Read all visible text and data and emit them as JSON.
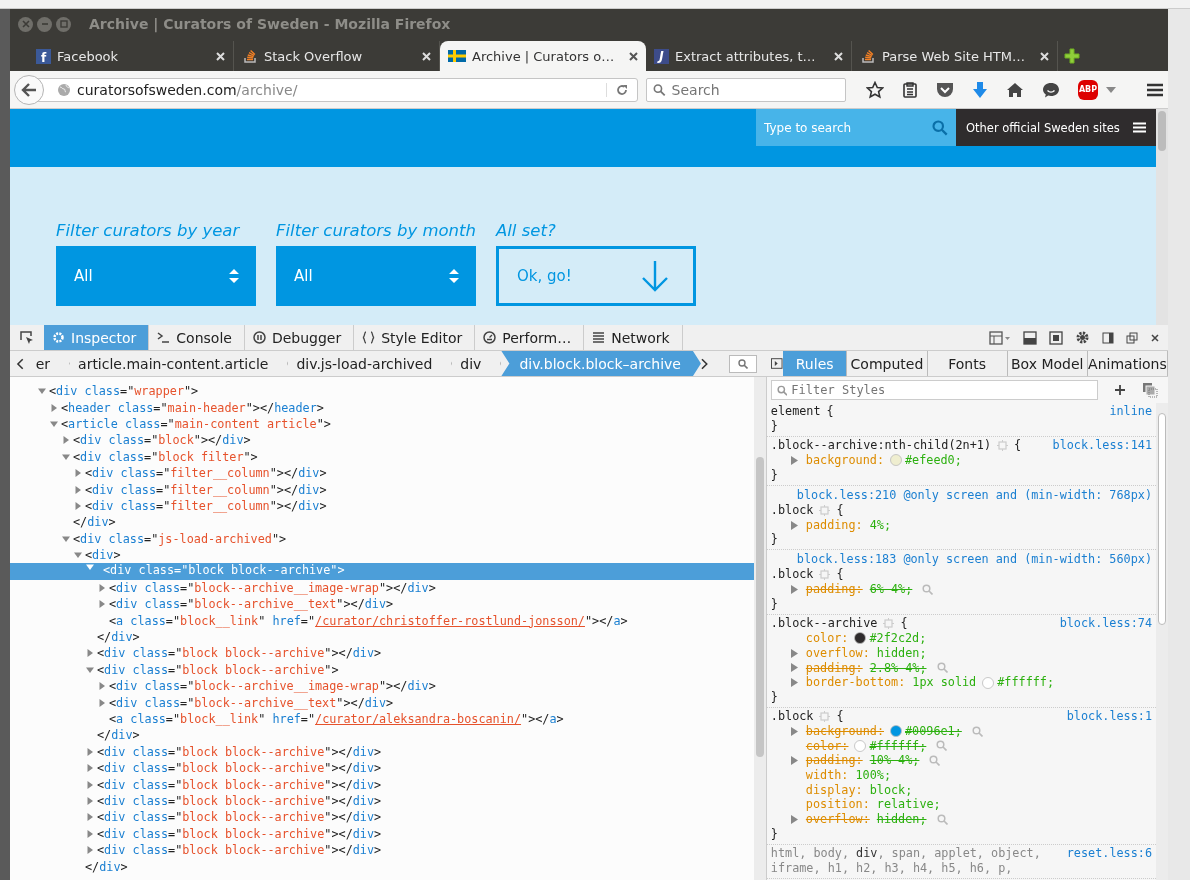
{
  "window": {
    "title": "Archive | Curators of Sweden - Mozilla Firefox"
  },
  "tabs": [
    {
      "label": "Facebook",
      "selected": false,
      "kind": "letter",
      "icon_text": "f"
    },
    {
      "label": "Stack Overflow",
      "selected": false,
      "kind": "stack"
    },
    {
      "label": "Archive | Curators o…",
      "selected": true,
      "kind": "flag"
    },
    {
      "label": "Extract attributes, t…",
      "selected": false,
      "kind": "letter",
      "icon_text": "J"
    },
    {
      "label": "Parse Web Site HTM…",
      "selected": false,
      "kind": "stack"
    }
  ],
  "navbar": {
    "url_host": "curatorsofsweden.com",
    "url_path": "/archive/",
    "search_placeholder": "Search",
    "adblock_text": "ABP"
  },
  "page": {
    "search_placeholder": "Type to search",
    "sites_link": "Other official Sweden sites",
    "filters": [
      {
        "label": "Filter curators by year",
        "value": "All"
      },
      {
        "label": "Filter curators by month",
        "value": "All"
      }
    ],
    "submit": {
      "label": "All set?",
      "button": "Ok, go!"
    }
  },
  "devtools": {
    "tabs": [
      {
        "label": "Inspector",
        "selected": true,
        "kind": "gear"
      },
      {
        "label": "Console",
        "selected": false,
        "kind": "prompt"
      },
      {
        "label": "Debugger",
        "selected": false,
        "kind": "pause"
      },
      {
        "label": "Style Editor",
        "selected": false,
        "kind": "braces"
      },
      {
        "label": "Perform…",
        "selected": false,
        "kind": "gauge"
      },
      {
        "label": "Network",
        "selected": false,
        "kind": "lines"
      }
    ],
    "breadcrumbs": [
      {
        "label": "er",
        "selected": false
      },
      {
        "label": "article.main-content.article",
        "selected": false
      },
      {
        "label": "div.js-load-archived",
        "selected": false
      },
      {
        "label": "div",
        "selected": false
      },
      {
        "label": "div.block.block–archive",
        "selected": true
      }
    ],
    "side_tabs": [
      {
        "label": "Rules",
        "selected": true
      },
      {
        "label": "Computed",
        "selected": false
      },
      {
        "label": "Fonts",
        "selected": false
      },
      {
        "label": "Box Model",
        "selected": false
      },
      {
        "label": "Animations",
        "selected": false
      }
    ],
    "filter_placeholder": "Filter Styles",
    "tree": [
      {
        "kind": "node",
        "open": "<div class=\"wrapper\">",
        "expanded": true,
        "selected": false,
        "children": [
          {
            "kind": "node",
            "open": "<header class=\"main-header\"></header>",
            "expanded": false,
            "selected": false
          },
          {
            "kind": "node",
            "open": "<article class=\"main-content article\">",
            "expanded": true,
            "selected": false,
            "children": [
              {
                "kind": "node",
                "open": "<div class=\"block\"></div>",
                "expanded": false,
                "selected": false
              },
              {
                "kind": "node",
                "open": "<div class=\"block filter\">",
                "expanded": true,
                "selected": false,
                "close": "</div>",
                "children": [
                  {
                    "kind": "node",
                    "open": "<div class=\"filter__column\"></div>",
                    "expanded": false,
                    "selected": false
                  },
                  {
                    "kind": "node",
                    "open": "<div class=\"filter__column\"></div>",
                    "expanded": false,
                    "selected": false
                  },
                  {
                    "kind": "node",
                    "open": "<div class=\"filter__column\"></div>",
                    "expanded": false,
                    "selected": false
                  }
                ]
              },
              {
                "kind": "node",
                "open": "<div class=\"js-load-archived\">",
                "expanded": true,
                "selected": false,
                "children": [
                  {
                    "kind": "node",
                    "open": "<div>",
                    "expanded": true,
                    "selected": false,
                    "close": "</div>",
                    "children": [
                      {
                        "kind": "node",
                        "open": "<div class=\"block block--archive\">",
                        "expanded": true,
                        "selected": true,
                        "close": "</div>",
                        "children": [
                          {
                            "kind": "node",
                            "open": "<div class=\"block--archive__image-wrap\"></div>",
                            "expanded": false,
                            "selected": false
                          },
                          {
                            "kind": "node",
                            "open": "<div class=\"block--archive__text\"></div>",
                            "expanded": false,
                            "selected": false
                          },
                          {
                            "kind": "leaf",
                            "open": "<a class=\"block__link\" href=\"",
                            "link": "/curator/christoffer-rostlund-jonsson/",
                            "after": "\"></a>",
                            "selected": false
                          }
                        ]
                      },
                      {
                        "kind": "node",
                        "open": "<div class=\"block block--archive\"></div>",
                        "expanded": false,
                        "selected": false
                      },
                      {
                        "kind": "node",
                        "open": "<div class=\"block block--archive\">",
                        "expanded": true,
                        "selected": false,
                        "close": "</div>",
                        "children": [
                          {
                            "kind": "node",
                            "open": "<div class=\"block--archive__image-wrap\"></div>",
                            "expanded": false,
                            "selected": false
                          },
                          {
                            "kind": "node",
                            "open": "<div class=\"block--archive__text\"></div>",
                            "expanded": false,
                            "selected": false
                          },
                          {
                            "kind": "leaf",
                            "open": "<a class=\"block__link\" href=\"",
                            "link": "/curator/aleksandra-boscanin/",
                            "after": "\"></a>",
                            "selected": false
                          }
                        ]
                      },
                      {
                        "kind": "node",
                        "open": "<div class=\"block block--archive\"></div>",
                        "expanded": false,
                        "selected": false
                      },
                      {
                        "kind": "node",
                        "open": "<div class=\"block block--archive\"></div>",
                        "expanded": false,
                        "selected": false
                      },
                      {
                        "kind": "node",
                        "open": "<div class=\"block block--archive\"></div>",
                        "expanded": false,
                        "selected": false
                      },
                      {
                        "kind": "node",
                        "open": "<div class=\"block block--archive\"></div>",
                        "expanded": false,
                        "selected": false
                      },
                      {
                        "kind": "node",
                        "open": "<div class=\"block block--archive\"></div>",
                        "expanded": false,
                        "selected": false
                      },
                      {
                        "kind": "node",
                        "open": "<div class=\"block block--archive\"></div>",
                        "expanded": false,
                        "selected": false
                      },
                      {
                        "kind": "node",
                        "open": "<div class=\"block block--archive\"></div>",
                        "expanded": false,
                        "selected": false
                      }
                    ]
                  }
                ]
              }
            ]
          }
        ]
      }
    ],
    "rules": [
      {
        "selector": "element",
        "open": "{",
        "close": "}",
        "source": "inline",
        "selector_icon": false,
        "dimmed": false
      },
      {
        "selector": ".block--archive:nth-child(2n+1)",
        "open": "{",
        "close": "}",
        "source": "block.less:141",
        "selector_icon": true,
        "dimmed": false,
        "properties": [
          {
            "name": "background:",
            "value": "#efeed0;",
            "color": "#efeed0",
            "expandable": true,
            "overridden": false
          }
        ]
      },
      {
        "media_source": "block.less:210",
        "media": "@only screen and (min-width: 768px)",
        "selector": ".block",
        "open": "{",
        "close": "}",
        "selector_icon": true,
        "dimmed": false,
        "properties": [
          {
            "name": "padding:",
            "value": "4%;",
            "expandable": true,
            "overridden": false
          }
        ]
      },
      {
        "media_source": "block.less:183",
        "media": "@only screen and (min-width: 560px)",
        "selector": ".block",
        "open": "{",
        "close": "}",
        "selector_icon": true,
        "dimmed": false,
        "properties": [
          {
            "name": "padding:",
            "value": "6% 4%;",
            "expandable": true,
            "overridden": true
          }
        ]
      },
      {
        "selector": ".block--archive",
        "open": "{",
        "close": "}",
        "source": "block.less:74",
        "selector_icon": true,
        "dimmed": false,
        "properties": [
          {
            "name": "color:",
            "value": "#2f2c2d;",
            "color": "#2f2c2d",
            "expandable": false,
            "overridden": false
          },
          {
            "name": "overflow:",
            "value": "hidden;",
            "expandable": true,
            "overridden": false
          },
          {
            "name": "padding:",
            "value": "2.8% 4%;",
            "expandable": true,
            "overridden": true
          },
          {
            "name": "border-bottom:",
            "prefix": "1px solid",
            "value": "#ffffff;",
            "color": "#ffffff",
            "expandable": true,
            "overridden": false
          }
        ]
      },
      {
        "selector": ".block",
        "open": "{",
        "close": "}",
        "source": "block.less:1",
        "selector_icon": true,
        "dimmed": false,
        "properties": [
          {
            "name": "background:",
            "value": "#0096e1;",
            "color": "#0096e1",
            "expandable": true,
            "overridden": true
          },
          {
            "name": "color:",
            "value": "#ffffff;",
            "color": "#ffffff",
            "expandable": false,
            "overridden": true
          },
          {
            "name": "padding:",
            "value": "10% 4%;",
            "expandable": true,
            "overridden": true
          },
          {
            "name": "width:",
            "value": "100%;",
            "expandable": false,
            "overridden": false
          },
          {
            "name": "display:",
            "value": "block;",
            "expandable": false,
            "overridden": false
          },
          {
            "name": "position:",
            "value": "relative;",
            "expandable": false,
            "overridden": false
          },
          {
            "name": "overflow:",
            "value": "hidden;",
            "expandable": true,
            "overridden": true
          }
        ]
      },
      {
        "selector": "html, body, **div**, span, applet, object, iframe, h1, h2, h3, h4, h5, h6, p,",
        "source": "reset.less:6",
        "selector_icon": false,
        "dimmed": true
      }
    ]
  }
}
